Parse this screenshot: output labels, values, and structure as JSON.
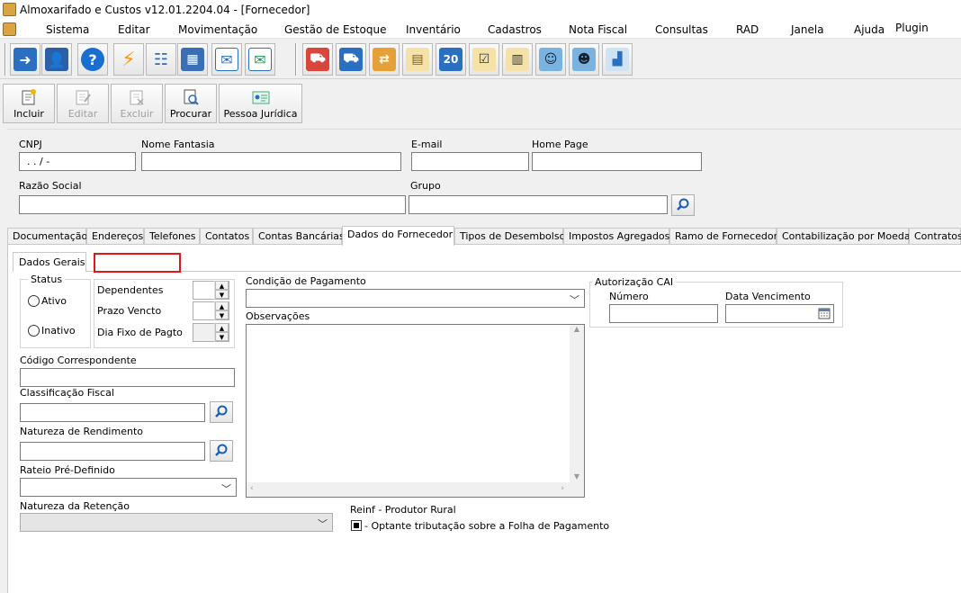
{
  "window": {
    "title": "Almoxarifado e Custos v12.01.2204.04 - [Fornecedor]"
  },
  "menu": [
    "Sistema",
    "Editar",
    "Movimentação",
    "Gestão de Estoque",
    "Inventário",
    "Cadastros",
    "Nota Fiscal",
    "Consultas",
    "RAD",
    "Janela",
    "Ajuda",
    "Plugin"
  ],
  "toolbar_icons": [
    "exit-icon",
    "user-key-icon",
    "help-icon",
    "lightning-icon",
    "org-chart-icon",
    "calculator-icon",
    "mail-icon",
    "mail-send-icon",
    "truck-fuel-icon",
    "truck-box-icon",
    "transfer-icon",
    "inventory-icon",
    "calendar-20-icon",
    "checklist-icon",
    "document-icon",
    "customer-icon",
    "users-icon",
    "stock-icon"
  ],
  "actions": {
    "incluir": "Incluir",
    "editar": "Editar",
    "excluir": "Excluir",
    "procurar": "Procurar",
    "pessoa_juridica": "Pessoa Jurídica"
  },
  "header": {
    "cnpj_label": "CNPJ",
    "cnpj_value": " .  .  /    -",
    "nome_fantasia_label": "Nome Fantasia",
    "email_label": "E-mail",
    "home_page_label": "Home Page",
    "razao_social_label": "Razão Social",
    "grupo_label": "Grupo"
  },
  "tabs": [
    "Documentação",
    "Endereços",
    "Telefones",
    "Contatos",
    "Contas Bancárias",
    "Dados do Fornecedor",
    "Tipos de Desembolso",
    "Impostos Agregados",
    "Ramo de Fornecedor",
    "Contabilização por Moeda",
    "Contratos"
  ],
  "subtab": "Dados Gerais",
  "form": {
    "status_label": "Status",
    "ativo": "Ativo",
    "inativo": "Inativo",
    "dependentes": "Dependentes",
    "prazo_vencto": "Prazo Vencto",
    "dia_fixo": "Dia Fixo de Pagto",
    "codigo_correspondente": "Código Correspondente",
    "classificacao_fiscal": "Classificação Fiscal",
    "natureza_rendimento": "Natureza de Rendimento",
    "rateio": "Rateio Pré-Definido",
    "natureza_retencao": "Natureza da Retenção",
    "condicao_pagamento": "Condição de Pagamento",
    "observacoes": "Observações",
    "autorizacao_cai": "Autorização CAI",
    "numero": "Número",
    "data_vencimento": "Data Vencimento",
    "reinf_title": "Reinf - Produtor Rural",
    "reinf_option": "- Optante tributação sobre a Folha de Pagamento",
    "reinf_checked": true
  },
  "colors": {
    "highlight_red": "#e0161b"
  }
}
